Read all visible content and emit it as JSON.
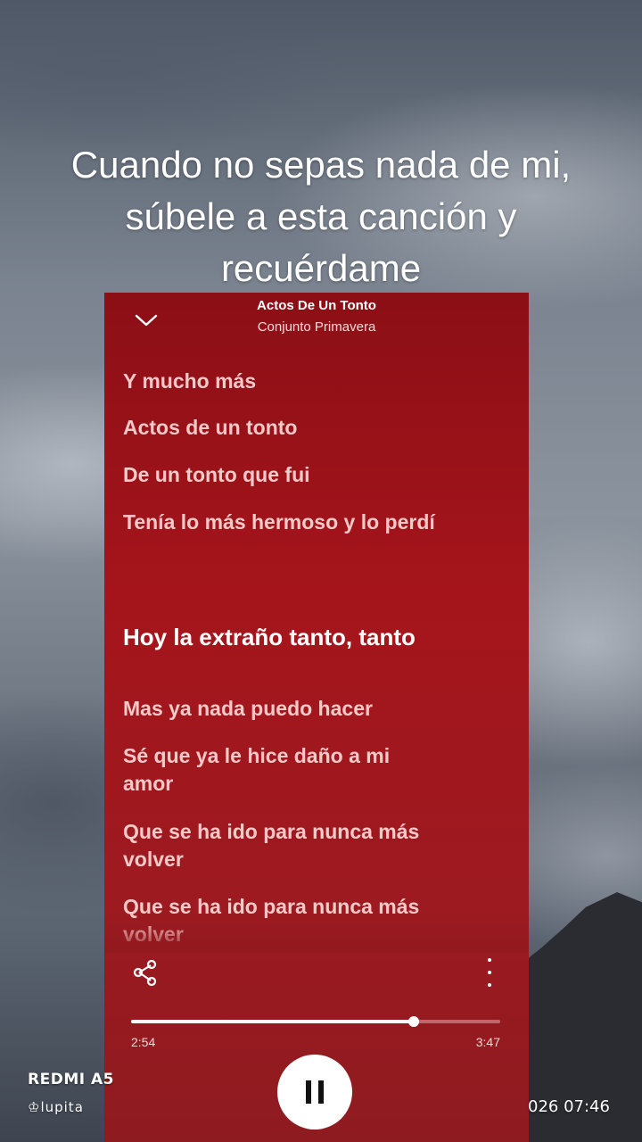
{
  "overlay": {
    "lines": [
      "Cuando no sepas nada de mi,",
      "súbele a esta canción y",
      "recuérdame"
    ]
  },
  "player": {
    "song_title": "Actos De Un Tonto",
    "artist": "Conjunto Primavera",
    "lyrics": [
      {
        "text": "Y mucho más",
        "active": false
      },
      {
        "text": "Actos de un tonto",
        "active": false
      },
      {
        "text": "De un tonto que fui",
        "active": false
      },
      {
        "text": "Tenía lo más hermoso y lo perdí",
        "active": false
      },
      {
        "text": "Hoy la extraño tanto, tanto",
        "active": true
      },
      {
        "text": "Mas ya nada puedo hacer",
        "active": false
      },
      {
        "text": "Sé que ya le hice daño a mi amor",
        "active": false
      },
      {
        "text": "Que se ha ido para nunca más volver",
        "active": false
      },
      {
        "text": "Que se ha ido para nunca más volver",
        "active": false
      }
    ],
    "elapsed": "2:54",
    "total": "3:47",
    "progress_fraction": 0.766,
    "icons": {
      "collapse": "chevron-down-icon",
      "share": "share-icon",
      "more": "more-vertical-icon",
      "play_state": "pause-icon"
    }
  },
  "watermark": {
    "device": "REDMI A5",
    "user": "♔lupita",
    "datetime": "026 07:46"
  },
  "colors": {
    "card_bg": "#9d1a20",
    "lyric_inactive": "#f6c9c9",
    "lyric_active": "#ffffff"
  }
}
